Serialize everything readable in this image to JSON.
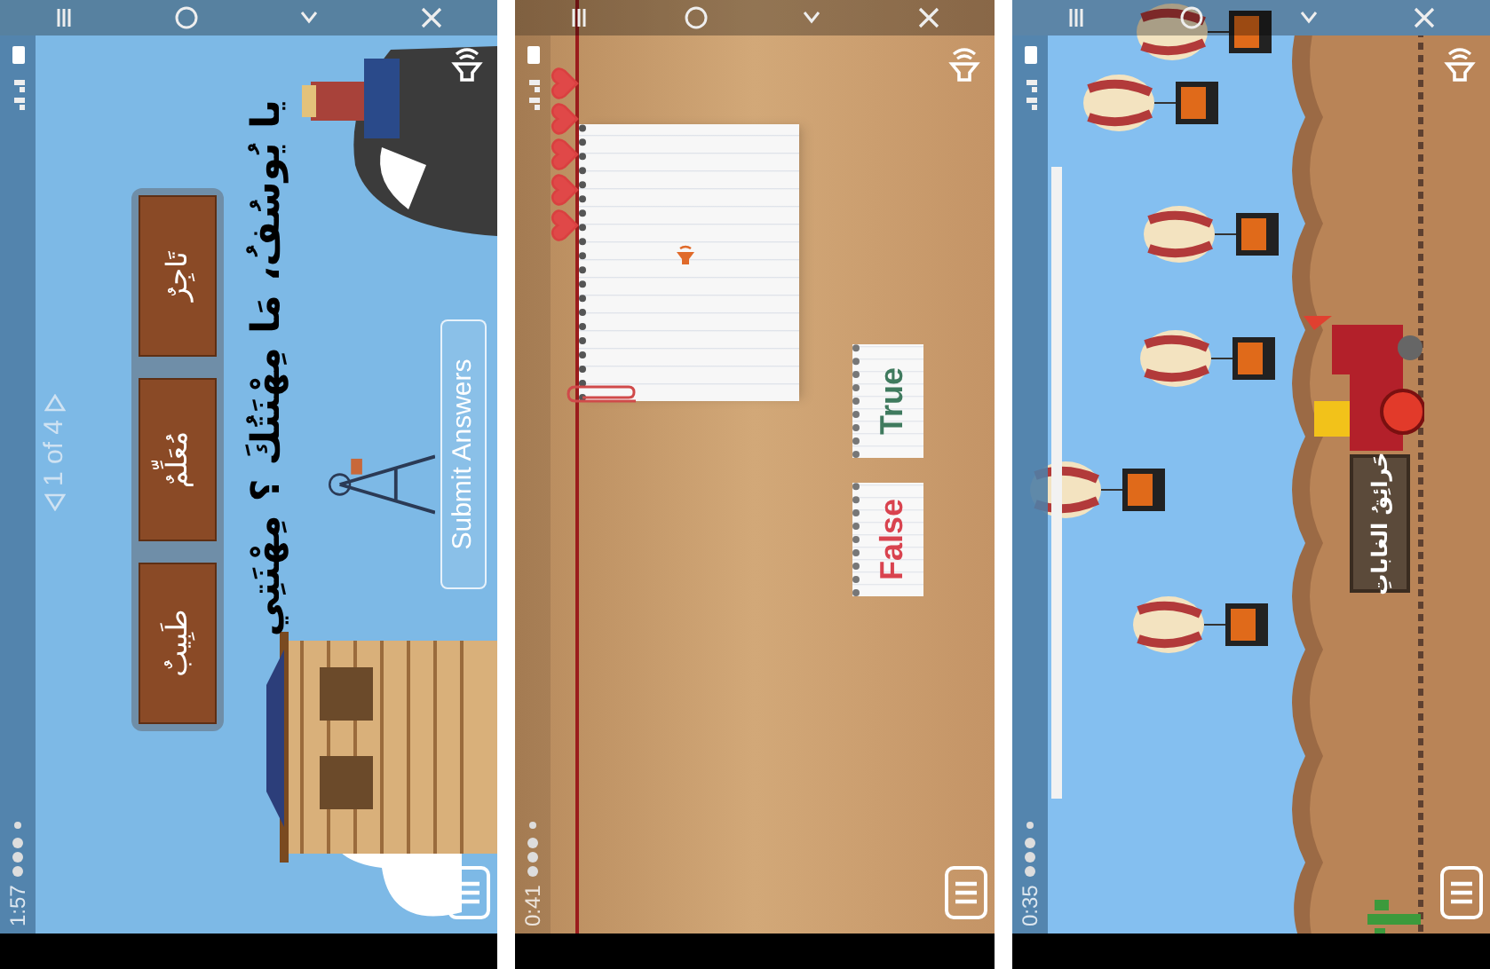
{
  "screens": [
    {
      "kind": "quiz",
      "status_bar": {
        "time": "1:57"
      },
      "pager": "1 of 4",
      "question": "يا يُوسُفُ، مَا مِهْنَتُكَ ؟ مِهْنَتِي",
      "answers": [
        {
          "label": "طَبِيبٌ"
        },
        {
          "label": "مُعَلِّمٌ"
        },
        {
          "label": "تَاجِرٌ"
        }
      ],
      "submit_button": "Submit Answers"
    },
    {
      "kind": "true_false",
      "status_bar": {
        "time": "0:41"
      },
      "lives": [
        {
          "filled": true
        },
        {
          "filled": true
        },
        {
          "filled": true
        },
        {
          "filled": true
        },
        {
          "filled": true
        }
      ],
      "choices": [
        {
          "label": "True",
          "color": "#3f7a5e"
        },
        {
          "label": "False",
          "color": "#d9434f"
        }
      ]
    },
    {
      "kind": "balloons",
      "status_bar": {
        "time": "0:35"
      },
      "timer": {
        "level": 1
      },
      "train_sign": "حَرائِقُ الغاباتِ"
    }
  ]
}
